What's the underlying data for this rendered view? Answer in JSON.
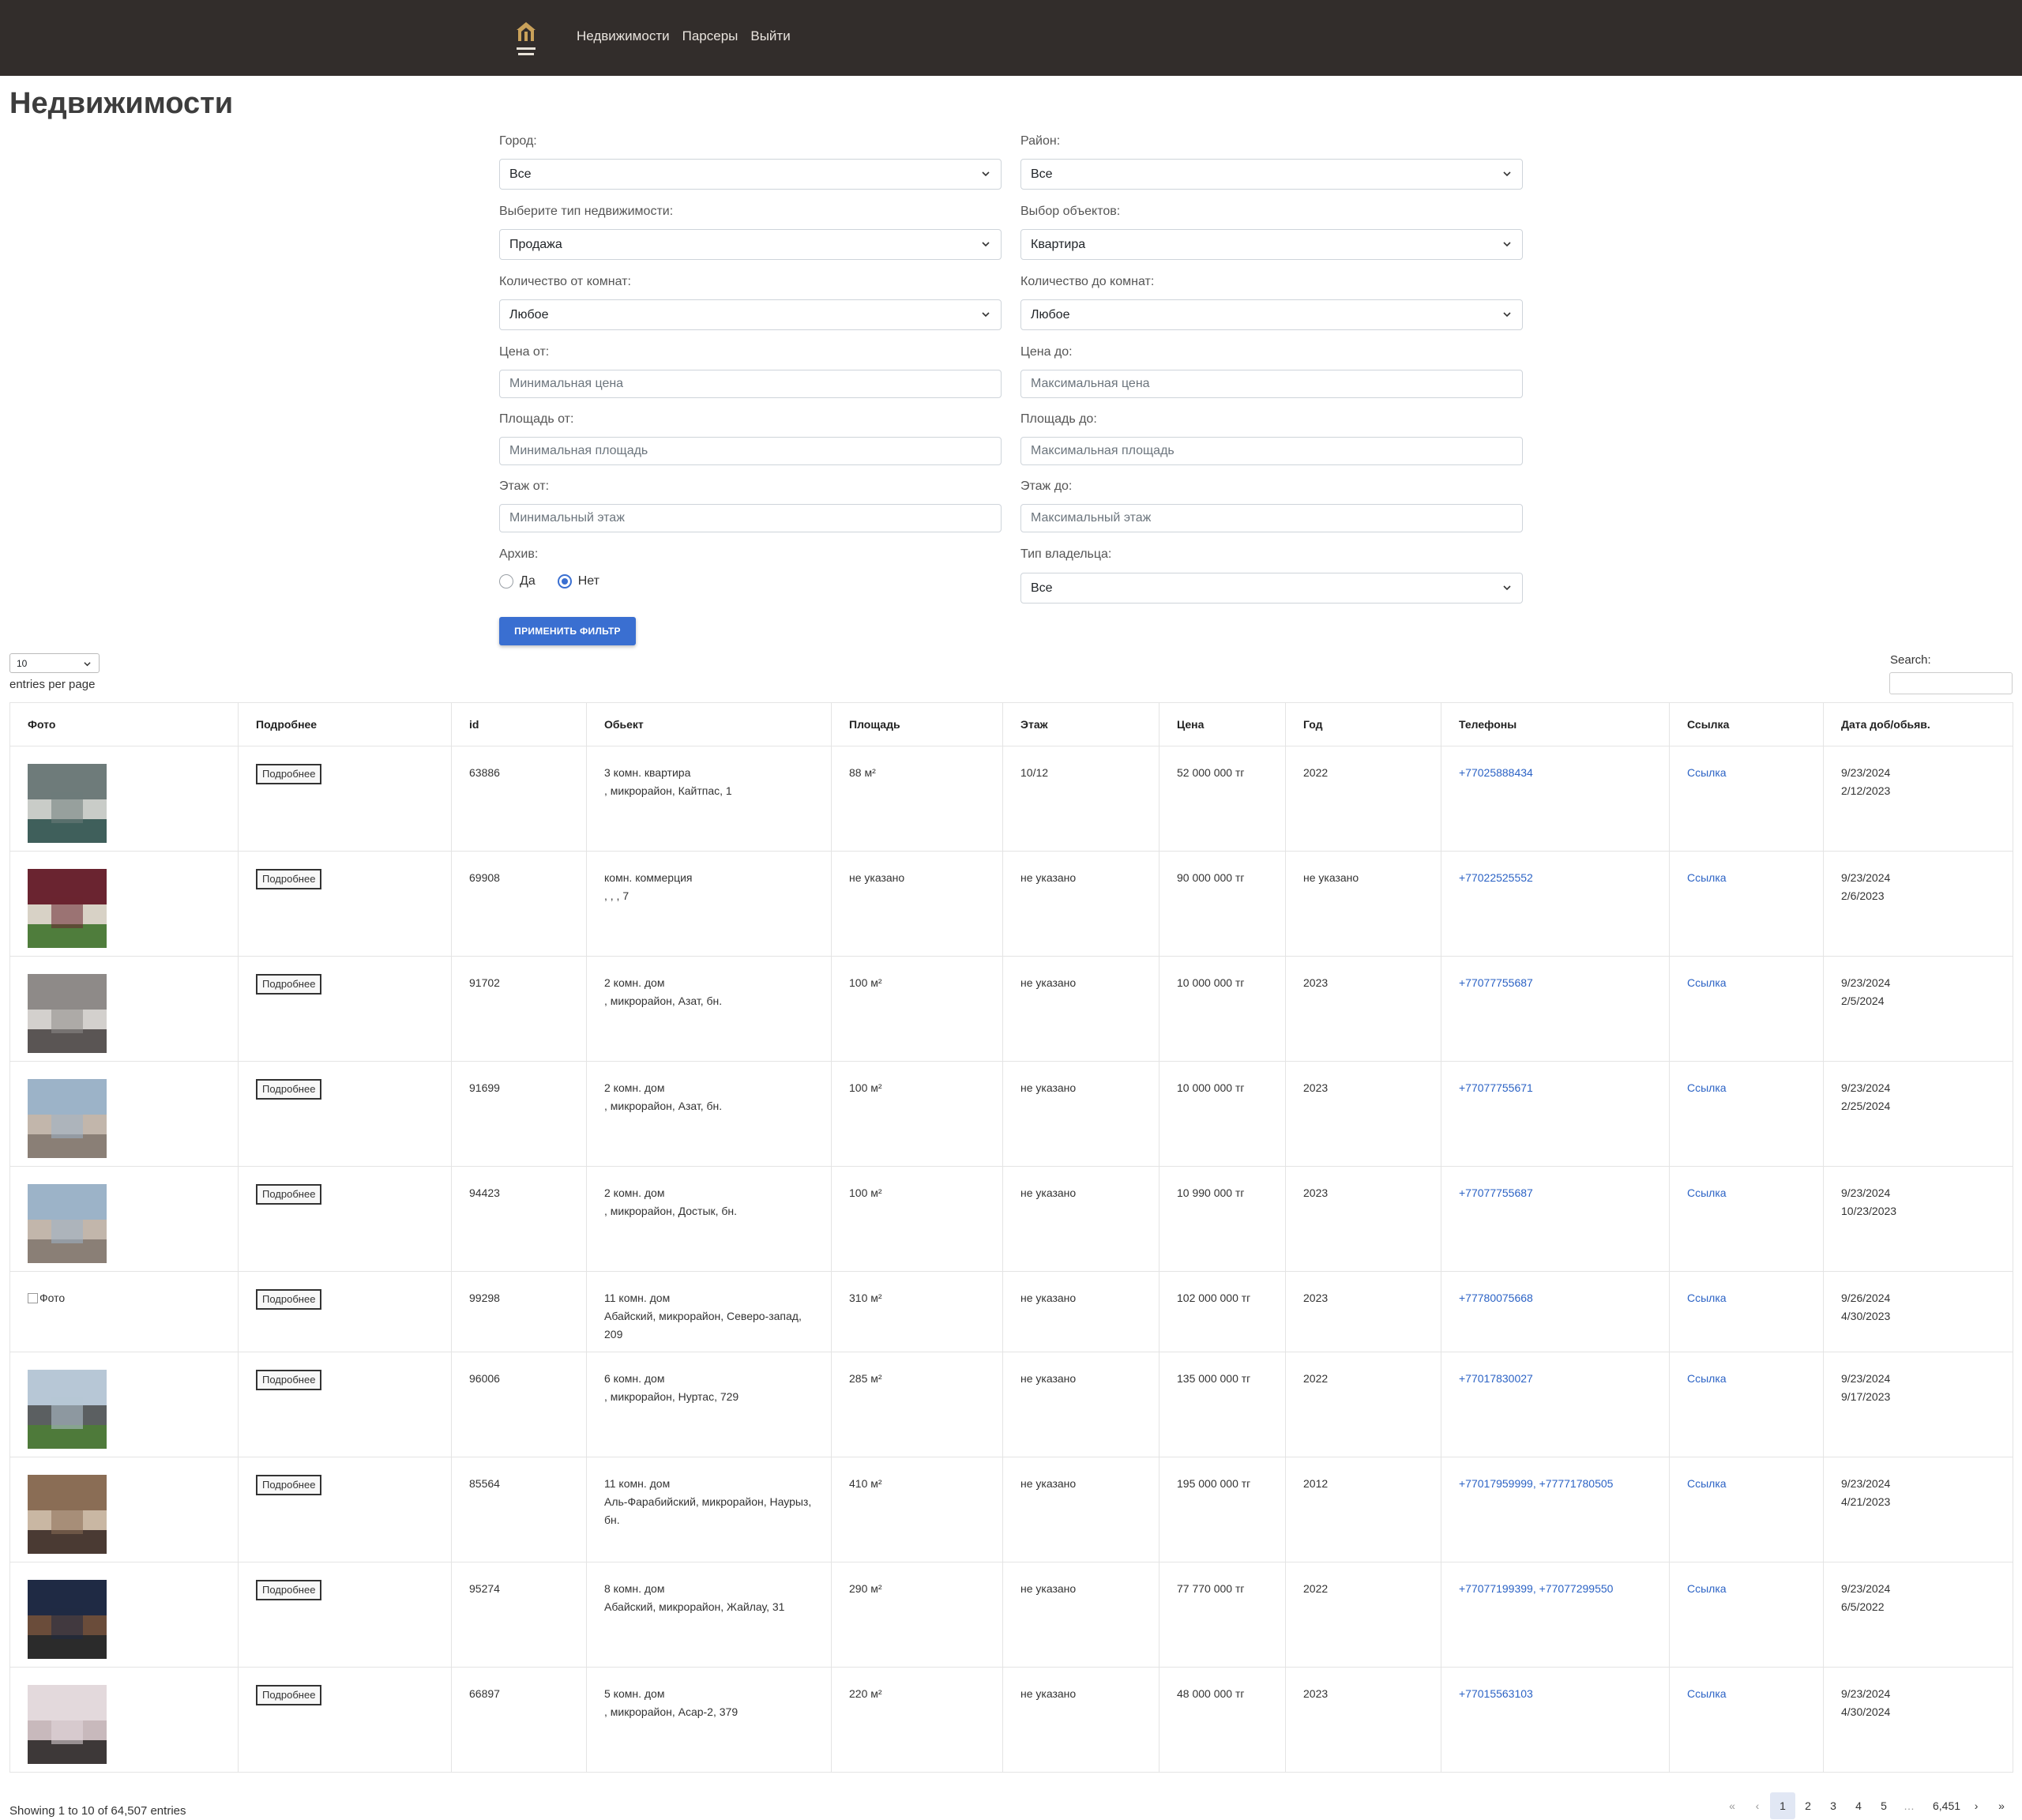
{
  "nav": {
    "logo_icon": "brand-logo-icon",
    "links": [
      "Недвижимости",
      "Парсеры",
      "Выйти"
    ]
  },
  "page_title": "Недвижимости",
  "filters": {
    "city": {
      "label": "Город:",
      "value": "Все"
    },
    "district": {
      "label": "Район:",
      "value": "Все"
    },
    "type": {
      "label": "Выберите тип недвижимости:",
      "value": "Продажа"
    },
    "object": {
      "label": "Выбор объектов:",
      "value": "Квартира"
    },
    "rooms_from": {
      "label": "Количество от комнат:",
      "value": "Любое"
    },
    "rooms_to": {
      "label": "Количество до комнат:",
      "value": "Любое"
    },
    "price_from": {
      "label": "Цена от:",
      "placeholder": "Минимальная цена"
    },
    "price_to": {
      "label": "Цена до:",
      "placeholder": "Максимальная цена"
    },
    "area_from": {
      "label": "Площадь от:",
      "placeholder": "Минимальная площадь"
    },
    "area_to": {
      "label": "Площадь до:",
      "placeholder": "Максимальная площадь"
    },
    "floor_from": {
      "label": "Этаж от:",
      "placeholder": "Минимальный этаж"
    },
    "floor_to": {
      "label": "Этаж до:",
      "placeholder": "Максимальный этаж"
    },
    "archive": {
      "label": "Архив:",
      "options": [
        "Да",
        "Нет"
      ],
      "selected": "Нет"
    },
    "owner": {
      "label": "Тип владельца:",
      "value": "Все"
    },
    "apply_label": "ПРИМЕНИТЬ ФИЛЬТР"
  },
  "table_controls": {
    "length_value": "10",
    "length_label": "entries per page",
    "search_label": "Search:"
  },
  "columns": [
    "Фото",
    "Подробнее",
    "id",
    "Обьект",
    "Площадь",
    "Этаж",
    "Цена",
    "Год",
    "Телефоны",
    "Ссылка",
    "Дата доб/обьяв."
  ],
  "detail_label": "Подробнее",
  "link_label": "Ссылка",
  "rows": [
    {
      "photo": "img",
      "photo_colors": [
        "#6e7b7a",
        "#c9ccc8",
        "#3f5f5b"
      ],
      "id": "63886",
      "object": "3 комн. квартира",
      "address": ", микрорайон, Кайтпас, 1",
      "area": "88 м²",
      "floor": "10/12",
      "price": "52 000 000 тг",
      "year": "2022",
      "phones": [
        "+77025888434"
      ],
      "date_added": "9/23/2024",
      "date_posted": "2/12/2023"
    },
    {
      "photo": "img",
      "photo_colors": [
        "#6a2430",
        "#d8d2c6",
        "#4f7d3c"
      ],
      "id": "69908",
      "object": "комн. коммерция",
      "address": ", , , 7",
      "area": "не указано",
      "floor": "не указано",
      "price": "90 000 000 тг",
      "year": "не указано",
      "phones": [
        "+77022525552"
      ],
      "date_added": "9/23/2024",
      "date_posted": "2/6/2023"
    },
    {
      "photo": "img",
      "photo_colors": [
        "#8e8a88",
        "#d3d0cd",
        "#5a5554"
      ],
      "id": "91702",
      "object": "2 комн. дом",
      "address": ", микрорайон, Азат, бн.",
      "area": "100 м²",
      "floor": "не указано",
      "price": "10 000 000 тг",
      "year": "2023",
      "phones": [
        "+77077755687"
      ],
      "date_added": "9/23/2024",
      "date_posted": "2/5/2024"
    },
    {
      "photo": "img",
      "photo_colors": [
        "#9cb3c8",
        "#c2b6ab",
        "#8a7f76"
      ],
      "id": "91699",
      "object": "2 комн. дом",
      "address": ", микрорайон, Азат, бн.",
      "area": "100 м²",
      "floor": "не указано",
      "price": "10 000 000 тг",
      "year": "2023",
      "phones": [
        "+77077755671"
      ],
      "date_added": "9/23/2024",
      "date_posted": "2/25/2024"
    },
    {
      "photo": "img",
      "photo_colors": [
        "#9cb3c8",
        "#c2b6ab",
        "#8a7f76"
      ],
      "id": "94423",
      "object": "2 комн. дом",
      "address": ", микрорайон, Достык, бн.",
      "area": "100 м²",
      "floor": "не указано",
      "price": "10 990 000 тг",
      "year": "2023",
      "phones": [
        "+77077755687"
      ],
      "date_added": "9/23/2024",
      "date_posted": "10/23/2023"
    },
    {
      "photo": "broken",
      "photo_alt": "Фото",
      "id": "99298",
      "object": "11 комн. дом",
      "address": "Абайский, микрорайон, Северо-запад, 209",
      "area": "310 м²",
      "floor": "не указано",
      "price": "102 000 000 тг",
      "year": "2023",
      "phones": [
        "+77780075668"
      ],
      "date_added": "9/26/2024",
      "date_posted": "4/30/2023"
    },
    {
      "photo": "img",
      "photo_colors": [
        "#b7c7d6",
        "#5b5f61",
        "#4e7a3a"
      ],
      "id": "96006",
      "object": "6 комн. дом",
      "address": ", микрорайон, Нуртас, 729",
      "area": "285 м²",
      "floor": "не указано",
      "price": "135 000 000 тг",
      "year": "2022",
      "phones": [
        "+77017830027"
      ],
      "date_added": "9/23/2024",
      "date_posted": "9/17/2023"
    },
    {
      "photo": "img",
      "photo_colors": [
        "#8a6d55",
        "#c9b7a3",
        "#4a3a33"
      ],
      "id": "85564",
      "object": "11 комн. дом",
      "address": "Аль-Фарабийский, микрорайон, Наурыз, бн.",
      "area": "410 м²",
      "floor": "не указано",
      "price": "195 000 000 тг",
      "year": "2012",
      "phones": [
        "+77017959999",
        "+77771780505"
      ],
      "date_added": "9/23/2024",
      "date_posted": "4/21/2023"
    },
    {
      "photo": "img",
      "photo_colors": [
        "#1f2a44",
        "#6a4c3a",
        "#2b2b2b"
      ],
      "id": "95274",
      "object": "8 комн. дом",
      "address": "Абайский, микрорайон, Жайлау, 31",
      "area": "290 м²",
      "floor": "не указано",
      "price": "77 770 000 тг",
      "year": "2022",
      "phones": [
        "+77077199399",
        "+77077299550"
      ],
      "date_added": "9/23/2024",
      "date_posted": "6/5/2022"
    },
    {
      "photo": "img",
      "photo_colors": [
        "#e3d9dc",
        "#c8b9bc",
        "#3d3838"
      ],
      "id": "66897",
      "object": "5 комн. дом",
      "address": ", микрорайон, Асар-2, 379",
      "area": "220 м²",
      "floor": "не указано",
      "price": "48 000 000 тг",
      "year": "2023",
      "phones": [
        "+77015563103"
      ],
      "date_added": "9/23/2024",
      "date_posted": "4/30/2024"
    }
  ],
  "footer": {
    "showing": "Showing 1 to 10 of 64,507 entries",
    "pages": [
      "«",
      "‹",
      "1",
      "2",
      "3",
      "4",
      "5",
      "…",
      "6,451",
      "›",
      "»"
    ],
    "active_page": "1"
  }
}
